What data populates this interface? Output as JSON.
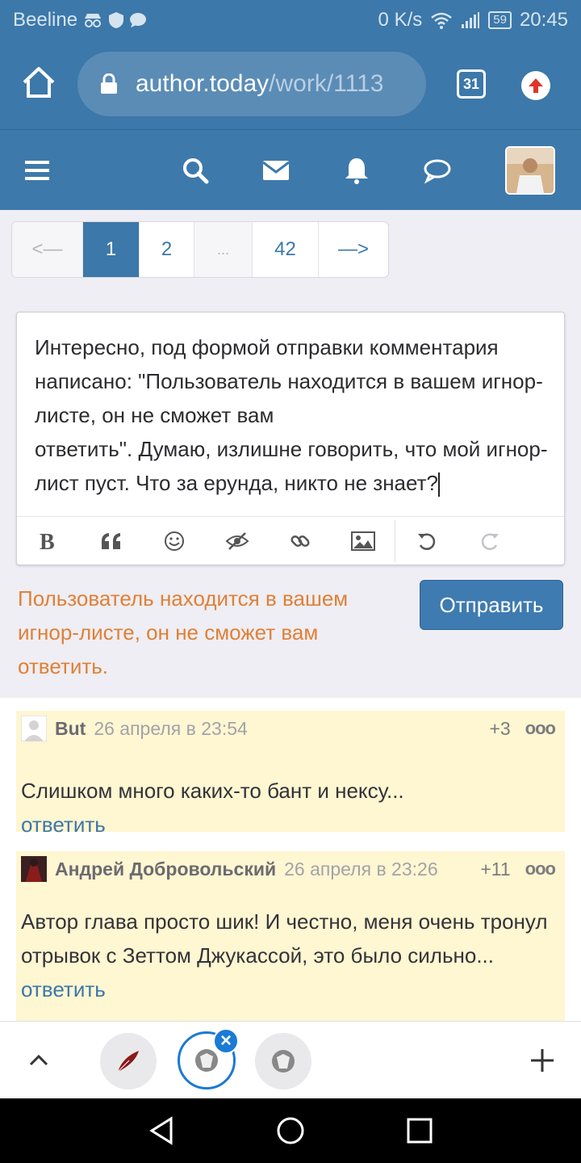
{
  "status_bar": {
    "carrier": "Beeline",
    "speed": "0 K/s",
    "battery": "59",
    "time": "20:45"
  },
  "browser": {
    "url_host": "author.today",
    "url_path": "/work/1113",
    "tab_count": "31"
  },
  "pagination": {
    "prev": "<—",
    "pages": [
      "1",
      "2",
      "...",
      "42"
    ],
    "next": "—>"
  },
  "editor": {
    "text": "Интересно, под формой отправки комментария написано: \"Пользователь находится в вашем игнор-листе, он не сможет вам\nответить\". Думаю, излишне говорить, что мой игнор-лист пуст. Что за ерунда, никто не знает?"
  },
  "warning": "Пользователь находится в вашем игнор-листе, он не сможет вам ответить.",
  "send_label": "Отправить",
  "comments": [
    {
      "author": "But",
      "date": "26 апреля в 23:54",
      "score": "+3",
      "text": "Слишком много каких-то бант и нексу...",
      "reply": "ответить"
    },
    {
      "author": "Андрей Добровольский",
      "date": "26 апреля в 23:26",
      "score": "+11",
      "text": "Автор глава просто шик! И честно, меня очень тронул отрывок с Зеттом Джукассой, это было сильно...",
      "reply": "ответить"
    }
  ],
  "colors": {
    "brand_blue": "#3c78a9",
    "warning_orange": "#e08036",
    "comment_bg": "#fff6d2",
    "active_tab_blue": "#1b7ad4"
  }
}
